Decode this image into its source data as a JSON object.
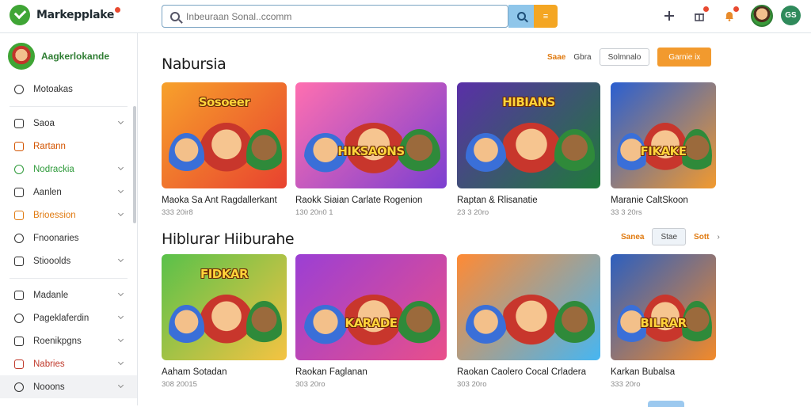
{
  "app": {
    "name": "Markepplake"
  },
  "search": {
    "placeholder": "Inbeuraan Sonal..ccomm",
    "filter_label": "≡"
  },
  "topbar": {
    "chip": "GS"
  },
  "profile": {
    "name": "Aagkerlokande",
    "sub": ""
  },
  "sidebar": {
    "items": [
      {
        "label": "Motoakas",
        "color": "#333333",
        "chevron": false,
        "icon": "clock-icon"
      },
      {
        "label": "Saoa",
        "color": "#333333",
        "chevron": true,
        "icon": "tag-icon"
      },
      {
        "label": "Rartann",
        "color": "#d35400",
        "chevron": false,
        "icon": "box-icon"
      },
      {
        "label": "Nodrackia",
        "color": "#2e9a3a",
        "chevron": true,
        "icon": "grid-icon"
      },
      {
        "label": "Aanlen",
        "color": "#333333",
        "chevron": true,
        "icon": "chat-icon"
      },
      {
        "label": "Brioession",
        "color": "#e07a10",
        "chevron": true,
        "icon": "coin-icon"
      },
      {
        "label": "Fnoonaries",
        "color": "#333333",
        "chevron": false,
        "icon": "user-icon"
      },
      {
        "label": "Stiooolds",
        "color": "#333333",
        "chevron": true,
        "icon": "doc-icon"
      },
      {
        "label": "Madanle",
        "color": "#333333",
        "chevron": true,
        "icon": "alert-icon"
      },
      {
        "label": "Pageklaferdin",
        "color": "#333333",
        "chevron": true,
        "icon": "history-icon"
      },
      {
        "label": "Roenikpgns",
        "color": "#333333",
        "chevron": true,
        "icon": "mail-icon"
      },
      {
        "label": "Nabries",
        "color": "#c0392b",
        "chevron": true,
        "icon": "calendar-icon"
      },
      {
        "label": "Nooons",
        "color": "#333333",
        "chevron": true,
        "icon": "settings-icon"
      }
    ]
  },
  "section1": {
    "title": "Nabursia",
    "action1": "Saae",
    "action2": "Gbra",
    "action3": "Solmnalo",
    "action4": "Garnie ix",
    "cards": [
      {
        "title": "Maoka Sa Ant Ragdallerkant",
        "meta": "333 20ir8",
        "art": "Sosoeer",
        "bg": "#f7a12b",
        "bg2": "#e8422f"
      },
      {
        "title": "Raokk Siaian Carlate Rogenion",
        "meta": "130 20n0 1",
        "art": "HIKSAONS",
        "bg": "#ff6fb0",
        "bg2": "#7b3fd1"
      },
      {
        "title": "Raptan & Rlisanatie",
        "meta": "23 3 20ro",
        "art": "HIBIANS",
        "bg": "#5a2fa8",
        "bg2": "#1f7a3a"
      },
      {
        "title": "Maranie CaltSkoon",
        "meta": "33 3 20rs",
        "art": "FIKAKE",
        "bg": "#2a5fd1",
        "bg2": "#f29a2e"
      }
    ]
  },
  "section2": {
    "title": "Hiblurar Hiiburahe",
    "action1": "Sanea",
    "action2": "Stae",
    "action3": "Sott",
    "cards": [
      {
        "title": "Aaham Sotadan",
        "meta": "308 20015",
        "art": "FIDKAR",
        "bg": "#59c14a",
        "bg2": "#f5c342"
      },
      {
        "title": "Raokan Faglanan",
        "meta": "303 20ro",
        "art": "KARADE",
        "bg": "#9b3fd4",
        "bg2": "#e94f8a"
      },
      {
        "title": "Raokan Caolero Cocal Crladera",
        "meta": "303 20ro",
        "art": "",
        "bg": "#ff8a34",
        "bg2": "#46b6f2"
      },
      {
        "title": "Karkan Bubalsa",
        "meta": "333 20ro",
        "art": "BILRAR",
        "bg": "#2c5fbf",
        "bg2": "#f28a2a"
      }
    ]
  }
}
